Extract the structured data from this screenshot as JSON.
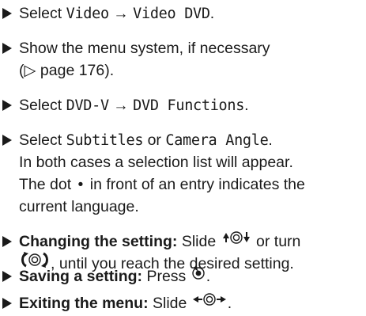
{
  "steps": [
    {
      "lines": [
        {
          "a": "Select ",
          "b": "Video",
          "c": " → ",
          "d": "Video DVD",
          "e": "."
        }
      ]
    },
    {
      "lines": [
        {
          "text": "Show the menu system, if necessary"
        },
        {
          "text": "(▷ page 176)."
        }
      ]
    },
    {
      "lines": [
        {
          "a": "Select ",
          "b": "DVD-V",
          "c": " → ",
          "d": "DVD Functions",
          "e": "."
        }
      ]
    },
    {
      "lines": [
        {
          "a": "Select ",
          "b": "Subtitles",
          "c": " or ",
          "d": "Camera Angle",
          "e": "."
        },
        {
          "text": "In both cases a selection list will appear."
        },
        {
          "a": "The dot ",
          "b": "•",
          "c": " in front of an entry indicates the"
        },
        {
          "text": "current language."
        }
      ]
    },
    {
      "lines": [
        {
          "bold": "Changing the setting:",
          "a": " Slide ",
          "b": " or turn"
        },
        {
          "a": ", until you reach the desired setting."
        }
      ]
    },
    {
      "lines": [
        {
          "bold": "Saving a setting:",
          "a": " Press ",
          "b": "."
        }
      ]
    },
    {
      "lines": [
        {
          "bold": "Exiting the menu:",
          "a": " Slide ",
          "b": "."
        }
      ]
    }
  ],
  "icons": {
    "slide_up_down": "slide-up-down-controller-icon",
    "turn": "turn-controller-icon",
    "press": "press-controller-icon",
    "slide_left_right": "slide-left-right-controller-icon"
  }
}
